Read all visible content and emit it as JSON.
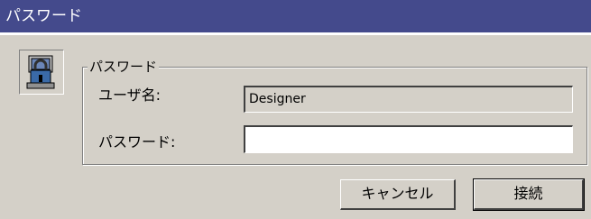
{
  "window": {
    "title": "パスワード"
  },
  "group": {
    "title": "パスワード"
  },
  "fields": {
    "username": {
      "label": "ユーザ名:",
      "value": "Designer"
    },
    "password": {
      "label": "パスワード:",
      "value": ""
    }
  },
  "buttons": {
    "cancel": "キャンセル",
    "connect": "接続"
  },
  "icons": {
    "dialog_icon": "lock-icon"
  },
  "colors": {
    "titlebar": "#444a8c",
    "face": "#d4d0c8"
  }
}
